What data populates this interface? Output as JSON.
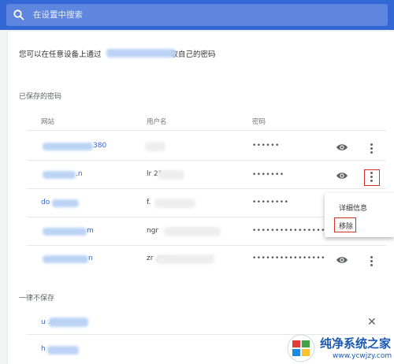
{
  "search": {
    "placeholder": "在设置中搜索"
  },
  "intro": {
    "prefix": "您可以在任意设备上通过",
    "suffix": "取自己的密码"
  },
  "saved": {
    "section_title": "已保存的密码",
    "headers": {
      "site": "网站",
      "username": "用户名",
      "password": "密码"
    },
    "rows": [
      {
        "site": "380",
        "username": "",
        "password": "••••••"
      },
      {
        "site": ".n",
        "username": "lr    25",
        "password": "•••••••"
      },
      {
        "site": "do",
        "username": "f.",
        "password": "••••••••"
      },
      {
        "site": "m",
        "username": "ngr",
        "password": "••••••••••••••••"
      },
      {
        "site": "n",
        "username": "zr              .com",
        "password": "••••••••••••••••"
      }
    ]
  },
  "menu": {
    "details": "详细信息",
    "remove": "移除"
  },
  "never": {
    "section_title": "一律不保存",
    "rows": [
      {
        "site": "u          .com"
      },
      {
        "site": "h"
      }
    ]
  },
  "watermark": {
    "title": "纯净系统之家",
    "url": "www.ycwjzy.com"
  },
  "colors": {
    "topbar": "#3367d6",
    "link": "#3367d6",
    "highlight": "#d93025"
  },
  "icons": [
    "search-icon",
    "eye-icon",
    "more-vert-icon",
    "close-icon"
  ]
}
